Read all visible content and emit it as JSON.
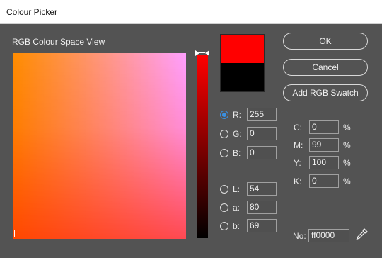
{
  "window": {
    "title": "Colour Picker"
  },
  "view": {
    "label": "RGB Colour Space View"
  },
  "swatch": {
    "new_color": "#ff0000",
    "old_color": "#000000"
  },
  "buttons": {
    "ok": "OK",
    "cancel": "Cancel",
    "add_swatch": "Add RGB Swatch"
  },
  "rgb": [
    {
      "label": "R:",
      "value": "255",
      "selected": true
    },
    {
      "label": "G:",
      "value": "0",
      "selected": false
    },
    {
      "label": "B:",
      "value": "0",
      "selected": false
    }
  ],
  "lab": [
    {
      "label": "L:",
      "value": "54",
      "selected": false
    },
    {
      "label": "a:",
      "value": "80",
      "selected": false
    },
    {
      "label": "b:",
      "value": "69",
      "selected": false
    }
  ],
  "cmyk": [
    {
      "label": "C:",
      "value": "0",
      "unit": "%"
    },
    {
      "label": "M:",
      "value": "99",
      "unit": "%"
    },
    {
      "label": "Y:",
      "value": "100",
      "unit": "%"
    },
    {
      "label": "K:",
      "value": "0",
      "unit": "%"
    }
  ],
  "hex": {
    "label": "No:",
    "value": "ff0000"
  },
  "colors": {
    "accent": "#3a8fe0",
    "background": "#535353"
  }
}
